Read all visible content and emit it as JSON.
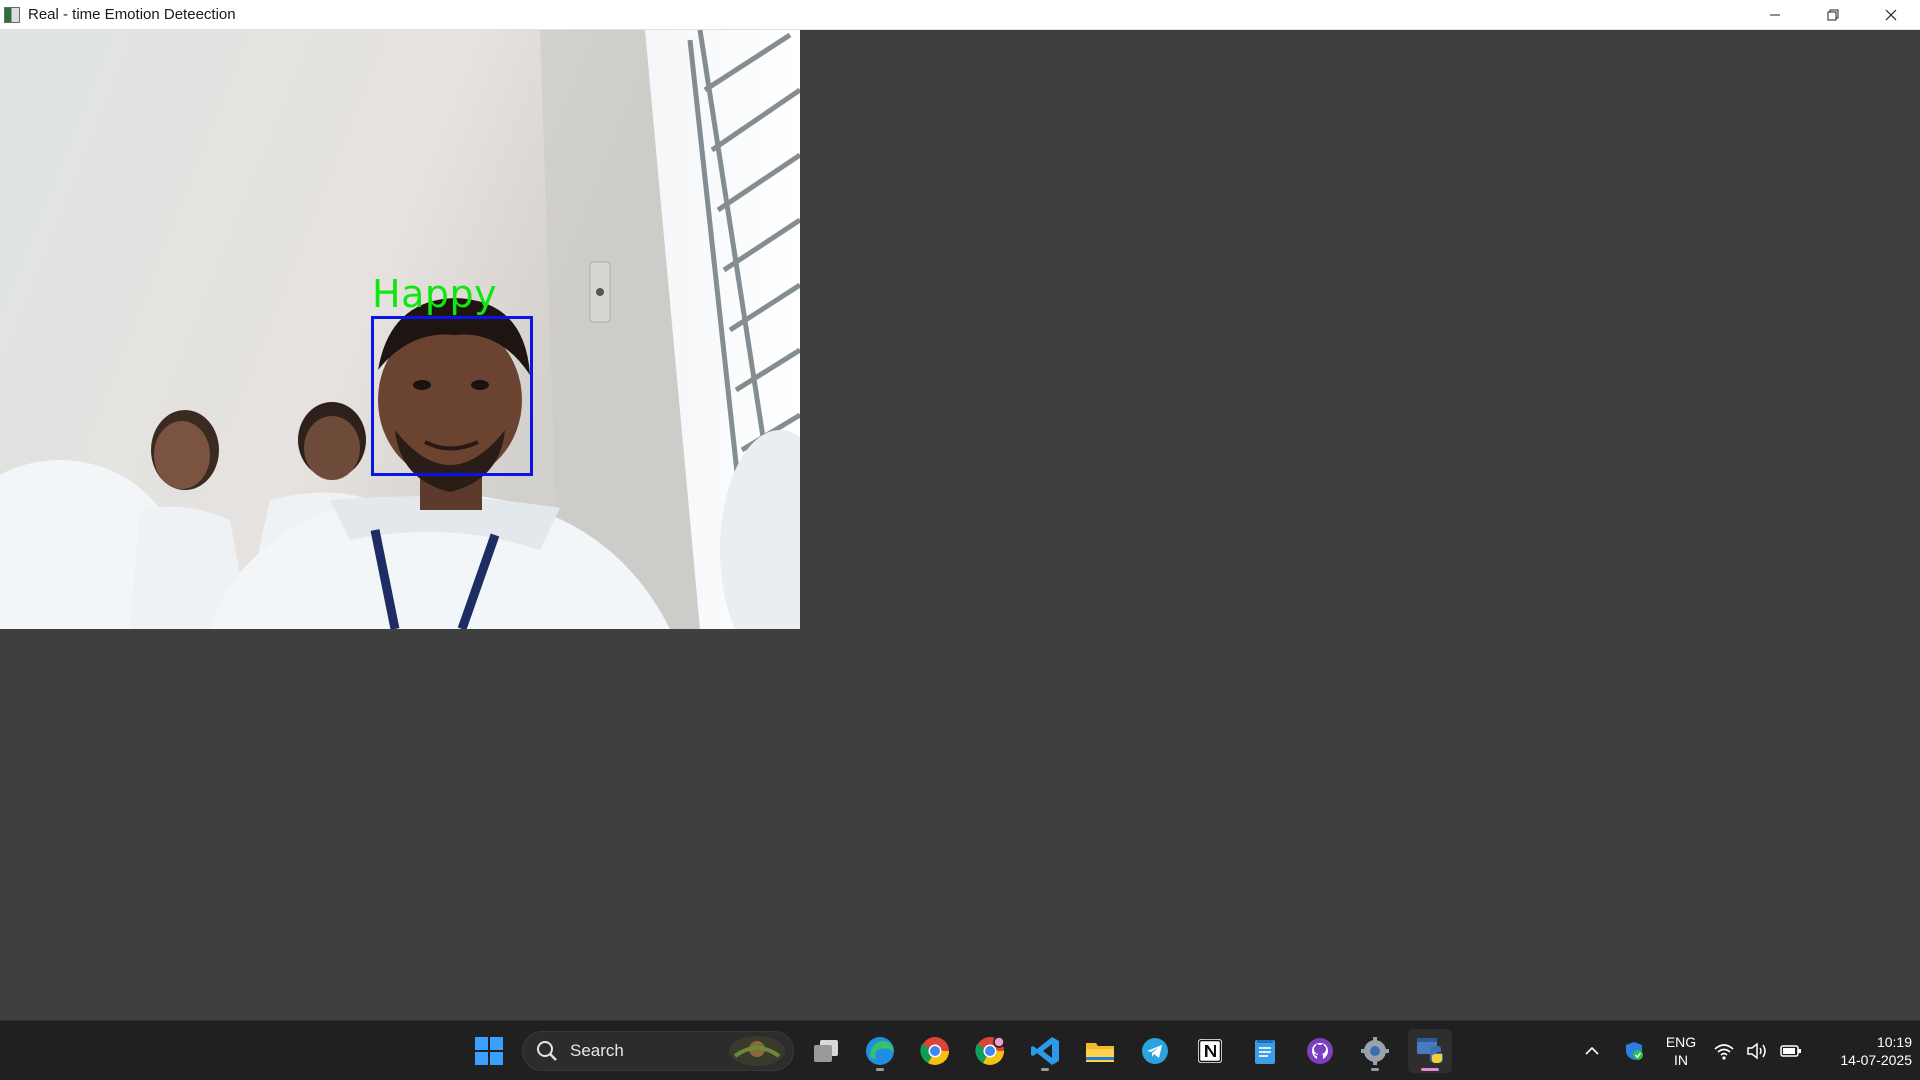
{
  "window": {
    "title": "Real - time Emotion Deteection",
    "controls": [
      "minimize-icon",
      "restore-icon",
      "close-icon"
    ]
  },
  "camera": {
    "detections": [
      {
        "label": "Happy",
        "box_color": "#0a14e6",
        "label_color": "#12e612"
      }
    ]
  },
  "colors": {
    "background": "#3f3f3f",
    "titlebar": "#ffffff",
    "taskbar": "#202020"
  },
  "taskbar": {
    "search_label": "Search",
    "apps": [
      "windows-start-icon",
      "task-view-icon",
      "edge-icon",
      "chrome-icon",
      "chrome-profile-icon",
      "vscode-icon",
      "file-explorer-icon",
      "telegram-icon",
      "notion-icon",
      "notepad-icon",
      "github-desktop-icon",
      "settings-icon",
      "python-icon"
    ],
    "tray": {
      "language_line1": "ENG",
      "language_line2": "IN",
      "time": "10:19",
      "date": "14-07-2025"
    }
  }
}
